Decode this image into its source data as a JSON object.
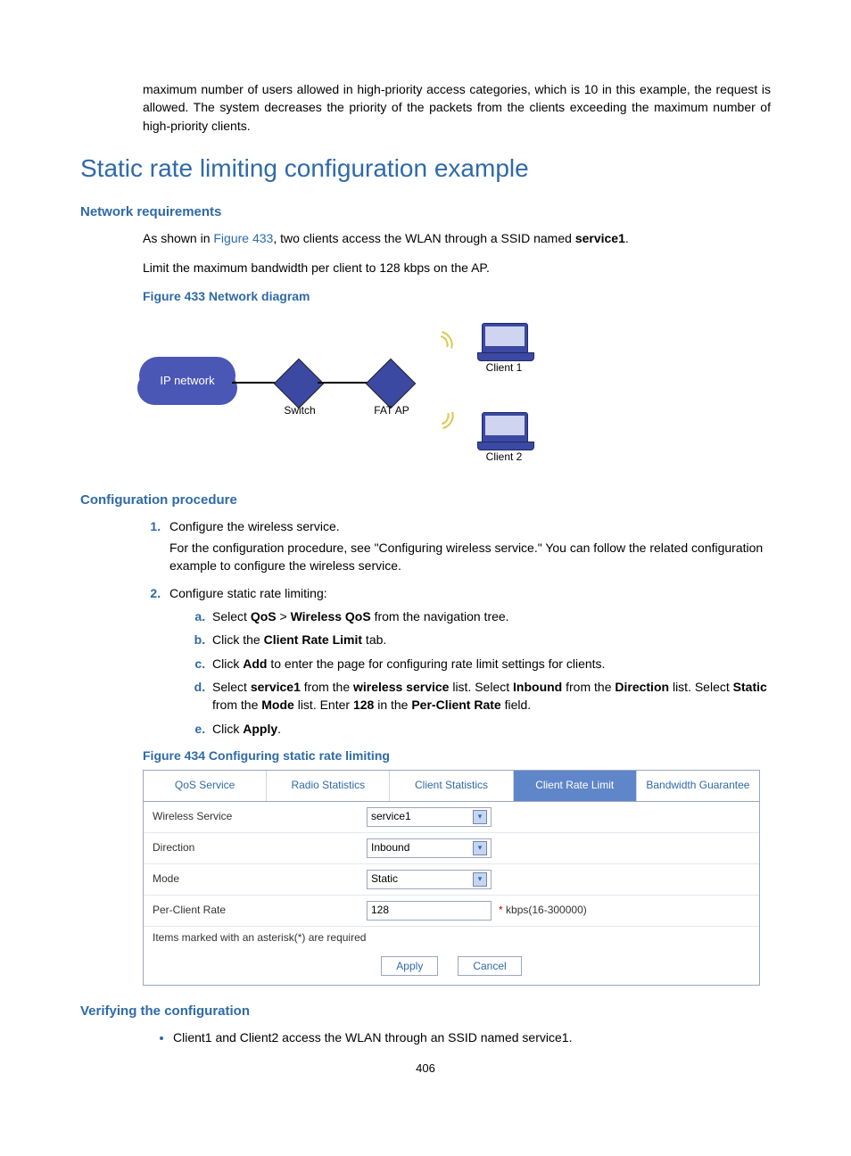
{
  "intro": "maximum number of users allowed in high-priority access categories, which is 10 in this example, the request is allowed. The system decreases the priority of the packets from the clients exceeding the maximum number of high-priority clients.",
  "h1": "Static rate limiting configuration example",
  "h2_netreq": "Network requirements",
  "netreq_line1_a": "As shown in ",
  "netreq_line1_link": "Figure 433",
  "netreq_line1_b": ", two clients access the WLAN through a SSID named ",
  "netreq_line1_bold": "service1",
  "netreq_line1_c": ".",
  "netreq_line2": "Limit the maximum bandwidth per client to 128 kbps on the AP.",
  "figcap1": "Figure 433 Network diagram",
  "diagram": {
    "cloud": "IP network",
    "switch": "Switch",
    "ap": "FAT AP",
    "client1": "Client 1",
    "client2": "Client 2"
  },
  "h2_proc": "Configuration procedure",
  "steps": {
    "s1a": "Configure the wireless service.",
    "s1b": "For the configuration procedure, see \"Configuring wireless service.\" You can follow the related configuration example to configure the wireless service.",
    "s2": "Configure static rate limiting:",
    "sub_a_pre": "Select ",
    "sub_a_bold1": "QoS",
    "sub_a_mid": " > ",
    "sub_a_bold2": "Wireless QoS",
    "sub_a_post": " from the navigation tree.",
    "sub_b_pre": "Click the ",
    "sub_b_bold": "Client Rate Limit",
    "sub_b_post": " tab.",
    "sub_c_pre": "Click ",
    "sub_c_bold": "Add",
    "sub_c_post": " to enter the page for configuring rate limit settings for clients.",
    "sub_d_1": "Select ",
    "sub_d_b1": "service1",
    "sub_d_2": " from the ",
    "sub_d_b2": "wireless service",
    "sub_d_3": " list. Select ",
    "sub_d_b3": "Inbound",
    "sub_d_4": " from the ",
    "sub_d_b4": "Direction",
    "sub_d_5": " list. Select ",
    "sub_d_b5": "Static",
    "sub_d_6": " from the ",
    "sub_d_b6": "Mode",
    "sub_d_7": " list. Enter ",
    "sub_d_b7": "128",
    "sub_d_8": " in the ",
    "sub_d_b8": "Per-Client Rate",
    "sub_d_9": " field.",
    "sub_e_pre": "Click ",
    "sub_e_bold": "Apply",
    "sub_e_post": "."
  },
  "figcap2": "Figure 434 Configuring static rate limiting",
  "ui": {
    "tabs": {
      "qos": "QoS Service",
      "radio": "Radio Statistics",
      "client_stats": "Client Statistics",
      "client_rate": "Client Rate Limit",
      "bw": "Bandwidth Guarantee"
    },
    "rows": {
      "wireless_label": "Wireless Service",
      "wireless_value": "service1",
      "direction_label": "Direction",
      "direction_value": "Inbound",
      "mode_label": "Mode",
      "mode_value": "Static",
      "rate_label": "Per-Client Rate",
      "rate_value": "128",
      "rate_hint": "kbps(16-300000)",
      "asterisk": "*"
    },
    "footnote": "Items marked with an asterisk(*) are required",
    "apply": "Apply",
    "cancel": "Cancel"
  },
  "h2_verify": "Verifying the configuration",
  "verify_bullet": "Client1 and Client2 access the WLAN through an SSID named service1.",
  "pagenum": "406"
}
